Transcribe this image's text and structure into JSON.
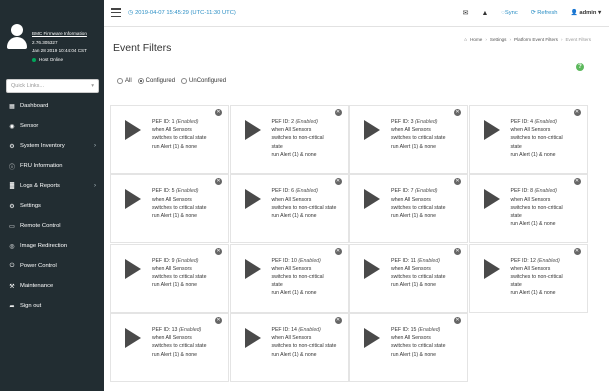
{
  "sidebar": {
    "user": {
      "fw_title": "BMC Firmware Information",
      "version": "2.76.305327",
      "build_date": "Jan 28 2019 10:44:04 CST",
      "host_status": "Host Online"
    },
    "search_placeholder": "Quick Links...",
    "items": [
      {
        "label": "Dashboard",
        "icon": "dashboard-icon",
        "glyph": "▦",
        "chevron": false
      },
      {
        "label": "Sensor",
        "icon": "sensor-icon",
        "glyph": "◉",
        "chevron": false
      },
      {
        "label": "System Inventory",
        "icon": "system-inventory-icon",
        "glyph": "⚙",
        "chevron": true
      },
      {
        "label": "FRU Information",
        "icon": "info-icon",
        "glyph": "ⓘ",
        "chevron": false
      },
      {
        "label": "Logs & Reports",
        "icon": "chart-icon",
        "glyph": "▓",
        "chevron": true
      },
      {
        "label": "Settings",
        "icon": "gear-icon",
        "glyph": "⚙",
        "chevron": false
      },
      {
        "label": "Remote Control",
        "icon": "monitor-icon",
        "glyph": "▭",
        "chevron": false
      },
      {
        "label": "Image Redirection",
        "icon": "disc-icon",
        "glyph": "◎",
        "chevron": false
      },
      {
        "label": "Power Control",
        "icon": "power-icon",
        "glyph": "⏻",
        "chevron": false
      },
      {
        "label": "Maintenance",
        "icon": "wrench-icon",
        "glyph": "⚒",
        "chevron": false
      },
      {
        "label": "Sign out",
        "icon": "sign-out-icon",
        "glyph": "➦",
        "chevron": false
      }
    ]
  },
  "header": {
    "datetime": "2019-04-07 15:45:29 (UTC-11:30 UTC)",
    "sync_label": "Sync",
    "refresh_label": "Refresh",
    "user_label": "admin"
  },
  "main": {
    "title": "Event Filters",
    "breadcrumb": [
      "Home",
      "Settings",
      "Platform Event Filters",
      "Event Filters"
    ],
    "filter_options": [
      {
        "label": "All",
        "selected": false
      },
      {
        "label": "Configured",
        "selected": true
      },
      {
        "label": "UnConfigured",
        "selected": false
      }
    ],
    "cards": [
      {
        "title": "PEF ID: 1",
        "status": "(Enabled)",
        "line2": "when All Sensors",
        "line3": "switches to critical state",
        "line4": "",
        "action": "run Alert (1) & none"
      },
      {
        "title": "PEF ID: 2",
        "status": "(Enabled)",
        "line2": "when All Sensors",
        "line3": "switches to non-critical",
        "line4": "state",
        "action": "run Alert (1) & none"
      },
      {
        "title": "PEF ID: 3",
        "status": "(Enabled)",
        "line2": "when All Sensors",
        "line3": "switches to critical state",
        "line4": "",
        "action": "run Alert (1) & none"
      },
      {
        "title": "PEF ID: 4",
        "status": "(Enabled)",
        "line2": "when All Sensors",
        "line3": "switches to non-critical",
        "line4": "state",
        "action": "run Alert (1) & none"
      },
      {
        "title": "PEF ID: 5",
        "status": "(Enabled)",
        "line2": "when All Sensors",
        "line3": "switches to critical state",
        "line4": "",
        "action": "run Alert (1) & none"
      },
      {
        "title": "PEF ID: 6",
        "status": "(Enabled)",
        "line2": "when All Sensors",
        "line3": "switches to non-critical state",
        "line4": "",
        "action": "run Alert (1) & none"
      },
      {
        "title": "PEF ID: 7",
        "status": "(Enabled)",
        "line2": "when All Sensors",
        "line3": "switches to critical state",
        "line4": "",
        "action": "run Alert (1) & none"
      },
      {
        "title": "PEF ID: 8",
        "status": "(Enabled)",
        "line2": "when All Sensors",
        "line3": "switches to non-critical",
        "line4": "state",
        "action": "run Alert (1) & none"
      },
      {
        "title": "PEF ID: 9",
        "status": "(Enabled)",
        "line2": "when All Sensors",
        "line3": "switches to critical state",
        "line4": "",
        "action": "run Alert (1) & none"
      },
      {
        "title": "PEF ID: 10",
        "status": "(Enabled)",
        "line2": "when All Sensors",
        "line3": "switches to non-critical",
        "line4": "state",
        "action": "run Alert (1) & none"
      },
      {
        "title": "PEF ID: 11",
        "status": "(Enabled)",
        "line2": "when All Sensors",
        "line3": "switches to critical state",
        "line4": "",
        "action": "run Alert (1) & none"
      },
      {
        "title": "PEF ID: 12",
        "status": "(Enabled)",
        "line2": "when All Sensors",
        "line3": "switches to non-critical",
        "line4": "state",
        "action": "run Alert (1) & none"
      },
      {
        "title": "PEF ID: 13",
        "status": "(Enabled)",
        "line2": "when All Sensors",
        "line3": "switches to critical state",
        "line4": "",
        "action": "run Alert (1) & none"
      },
      {
        "title": "PEF ID: 14",
        "status": "(Enabled)",
        "line2": "when All Sensors",
        "line3": "switches to non-critical state",
        "line4": "",
        "action": "run Alert (1) & none"
      },
      {
        "title": "PEF ID: 15",
        "status": "(Enabled)",
        "line2": "when All Sensors",
        "line3": "switches to critical state",
        "line4": "",
        "action": "run Alert (1) & none"
      }
    ]
  },
  "colors": {
    "sidebar_bg": "#222d32",
    "accent": "#2a8ec4",
    "online": "#00a65a",
    "help": "#5cb85c"
  }
}
